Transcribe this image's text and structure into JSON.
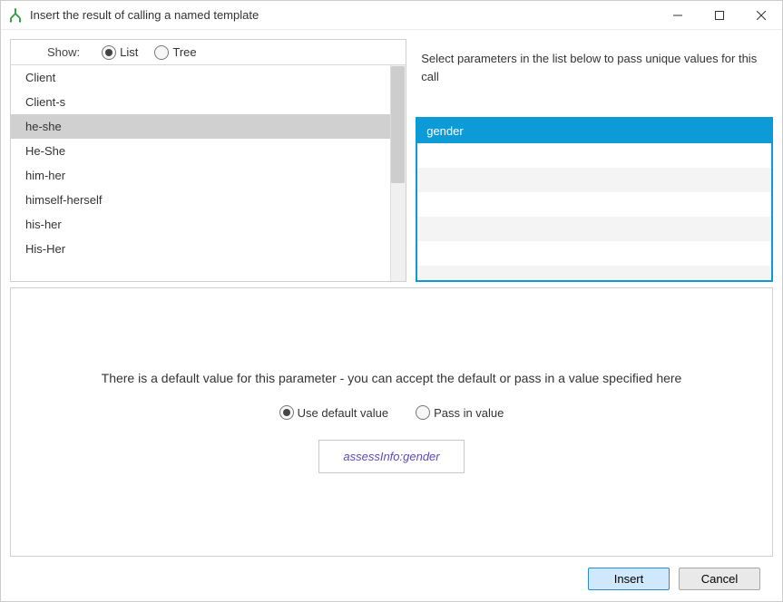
{
  "window": {
    "title": "Insert the result of calling a named template"
  },
  "show": {
    "label": "Show:",
    "list_label": "List",
    "tree_label": "Tree",
    "selected": "list"
  },
  "templates": {
    "items": [
      {
        "label": "Client"
      },
      {
        "label": "Client-s"
      },
      {
        "label": "he-she"
      },
      {
        "label": "He-She"
      },
      {
        "label": "him-her"
      },
      {
        "label": "himself-herself"
      },
      {
        "label": "his-her"
      },
      {
        "label": "His-Her"
      }
    ],
    "selected_index": 2
  },
  "parameters": {
    "instruction": "Select parameters in the list below to pass unique values for this call",
    "items": [
      {
        "label": "gender"
      }
    ],
    "selected_index": 0
  },
  "default_section": {
    "message": "There is a default value for this parameter - you can accept the default or pass in a value specified here",
    "use_default_label": "Use default value",
    "pass_in_label": "Pass in value",
    "selected": "use_default",
    "default_value": "assessInfo:gender"
  },
  "buttons": {
    "insert": "Insert",
    "cancel": "Cancel"
  }
}
